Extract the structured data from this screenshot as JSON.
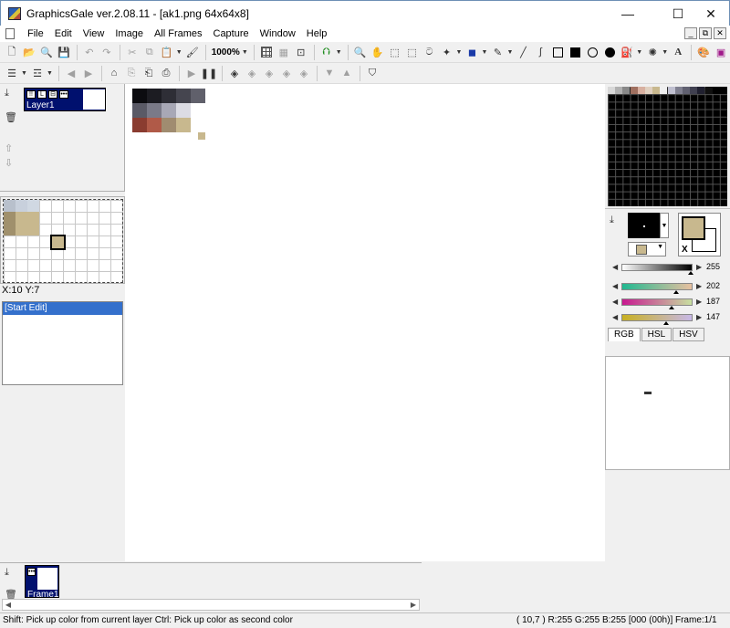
{
  "window": {
    "title": "GraphicsGale ver.2.08.11 - [ak1.png 64x64x8]",
    "minimize_glyph": "—",
    "maximize_glyph": "☐",
    "close_glyph": "✕"
  },
  "menu": {
    "items": [
      "File",
      "Edit",
      "View",
      "Image",
      "All Frames",
      "Capture",
      "Window",
      "Help"
    ],
    "mdi_buttons": [
      "_",
      "⧉",
      "✕"
    ]
  },
  "toolbar": {
    "zoom": "1000%"
  },
  "layers": {
    "layer_name": "Layer1",
    "flags": [
      "!!",
      "L",
      "⊟",
      "•••"
    ]
  },
  "preview": {
    "coords": "X:10 Y:7"
  },
  "history": {
    "items": [
      "[Start Edit]"
    ]
  },
  "frames": {
    "frame_name": "Frame1",
    "flag": "•••"
  },
  "colors": {
    "primary": "#000000",
    "secondary": "#c8b88e",
    "swap_label": "X",
    "gray_value": "255",
    "red_value": "202",
    "green_value": "187",
    "blue_value": "147",
    "tabs": [
      "RGB",
      "HSL",
      "HSV"
    ],
    "palette_top_row": [
      "#d8d8d8",
      "#b0b0b0",
      "#888888",
      "#a07060",
      "#d8b0a0",
      "#e0d0c0",
      "#c8b88e",
      "#f0f0f0",
      "#c0c0d0",
      "#808090",
      "#606070",
      "#404050",
      "#202030",
      "#101010",
      "#000000",
      "#000000"
    ]
  },
  "canvas_pixels": [
    {
      "col": 0,
      "row": 0,
      "color": "#0c0c10"
    },
    {
      "col": 1,
      "row": 0,
      "color": "#1c1c22"
    },
    {
      "col": 2,
      "row": 0,
      "color": "#2e2e36"
    },
    {
      "col": 3,
      "row": 0,
      "color": "#45454f"
    },
    {
      "col": 4,
      "row": 0,
      "color": "#60606b"
    },
    {
      "col": 0,
      "row": 1,
      "color": "#5a5a66"
    },
    {
      "col": 1,
      "row": 1,
      "color": "#7a7a88"
    },
    {
      "col": 2,
      "row": 1,
      "color": "#a8a8b6"
    },
    {
      "col": 3,
      "row": 1,
      "color": "#dcdce4"
    },
    {
      "col": 0,
      "row": 2,
      "color": "#8a3c30"
    },
    {
      "col": 1,
      "row": 2,
      "color": "#b05a48"
    },
    {
      "col": 2,
      "row": 2,
      "color": "#a08c70"
    },
    {
      "col": 3,
      "row": 2,
      "color": "#c8b88e"
    },
    {
      "col": 4.5,
      "row": 3,
      "color": "#c8b88e",
      "small": true
    }
  ],
  "preview_pixels": [
    {
      "col": 0,
      "row": 0,
      "color": "#b8c0cc"
    },
    {
      "col": 1,
      "row": 0,
      "color": "#c8d0dc"
    },
    {
      "col": 2,
      "row": 0,
      "color": "#d0d8e2"
    },
    {
      "col": 0,
      "row": 1,
      "color": "#a0906c"
    },
    {
      "col": 1,
      "row": 1,
      "color": "#c8b88e"
    },
    {
      "col": 2,
      "row": 1,
      "color": "#c8b88e"
    },
    {
      "col": 0,
      "row": 2,
      "color": "#a0906c"
    },
    {
      "col": 1,
      "row": 2,
      "color": "#c8b88e"
    },
    {
      "col": 2,
      "row": 2,
      "color": "#c8b88e"
    }
  ],
  "statusbar": {
    "hint": "Shift: Pick up color from current layer  Ctrl: Pick up color as second color",
    "info": "( 10,7 ) R:255 G:255 B:255  [000 (00h)]   Frame:1/1"
  }
}
